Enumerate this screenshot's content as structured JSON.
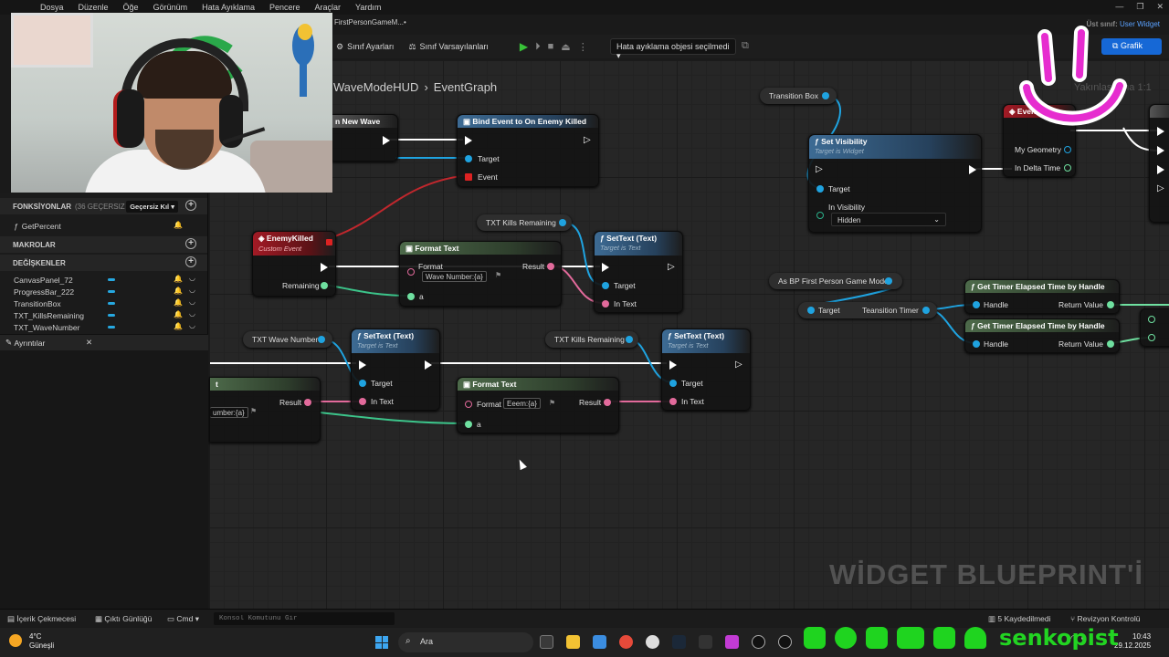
{
  "menu": [
    "Dosya",
    "Düzenle",
    "Öğe",
    "Görünüm",
    "Hata Ayıklama",
    "Pencere",
    "Araçlar",
    "Yardım"
  ],
  "tab_title": "FirstPersonGameM...•",
  "parent_class": {
    "label": "Üst sınıf:",
    "value": "User Widget"
  },
  "toolbar": {
    "class_settings": "Sınıf Ayarları",
    "class_defaults": "Sınıf Varsayılanları",
    "debug_select": "Hata ayıklama objesi seçilmedi",
    "graph_button": "Grafik"
  },
  "breadcrumb": {
    "widget": "WaveModeHUD",
    "sep": "›",
    "graph": "EventGraph"
  },
  "graph_faint_label": "Yakınlaştırma 1:1",
  "watermark": "WİDGET BLUEPRINT'İ",
  "left_panel": {
    "functions": {
      "title": "FONKSİYONLAR",
      "count": "(36 GEÇERSIZ KILIN",
      "override": "Geçersiz Kıl",
      "items": [
        "GetPercent"
      ]
    },
    "macros": {
      "title": "MAKROLAR"
    },
    "variables": {
      "title": "DEĞİŞKENLER",
      "items": [
        "CanvasPanel_72",
        "ProgressBar_222",
        "TransitionBox",
        "TXT_KillsRemaining",
        "TXT_WaveNumber"
      ]
    },
    "details_tab": "Ayrıntılar"
  },
  "nodes": {
    "on_new_wave": {
      "title": "n New Wave"
    },
    "bind_event": {
      "title": "Bind Event to On Enemy Killed",
      "pins": [
        "Target",
        "Event"
      ]
    },
    "enemy_killed": {
      "title": "EnemyKilled",
      "subtitle": "Custom Event",
      "pins": [
        "Remaining"
      ]
    },
    "format_text_1": {
      "title": "Format Text",
      "format_label": "Format",
      "format_value": "Wave Number:{a}",
      "result": "Result",
      "a": "a"
    },
    "settext_1": {
      "title": "SetText (Text)",
      "subtitle": "Target is Text",
      "pins": [
        "Target",
        "In Text"
      ]
    },
    "var_kills_1": "TXT Kills Remaining",
    "var_wave": "TXT Wave Number",
    "var_kills_2": "TXT Kills Remaining",
    "settext_2": {
      "title": "SetText (Text)",
      "subtitle": "Target is Text",
      "pins": [
        "Target",
        "In Text"
      ]
    },
    "settext_3": {
      "title": "SetText (Text)",
      "subtitle": "Target is Text",
      "pins": [
        "Target",
        "In Text"
      ]
    },
    "format_text_2": {
      "title": "Format Text",
      "format_label": "Format",
      "format_value": "Eeem:{a}",
      "result": "Result",
      "a": "a"
    },
    "left_partial": {
      "title": "t",
      "result": "Result",
      "format_value": "umber:{a}"
    },
    "transition_box": "Transition Box",
    "set_visibility": {
      "title": "Set Visibility",
      "subtitle": "Target is Widget",
      "pins": [
        "Target",
        "In Visibility"
      ],
      "visibility_value": "Hidden"
    },
    "event_tick": {
      "title": "Event Tick",
      "pins": [
        "My Geometry",
        "In Delta Time"
      ]
    },
    "cast_node": "As BP First Person Game Mode",
    "get_transition": {
      "target": "Target",
      "output": "Teansition Timer"
    },
    "timer_1": {
      "title": "Get Timer Elapsed Time by Handle",
      "handle": "Handle",
      "ret": "Return Value"
    },
    "timer_2": {
      "title": "Get Timer Elapsed Time by Handle",
      "handle": "Handle",
      "ret": "Return Value"
    }
  },
  "bottom_bar": {
    "content_drawer": "İçerik Çekmecesi",
    "output_log": "Çıktı Günlüğü",
    "cmd": "Cmd",
    "console_placeholder": "Konsol Komutunu Gir",
    "saved": "5 Kaydedilmedi",
    "revision": "Revizyon Kontrolü"
  },
  "taskbar": {
    "temperature": "4°C",
    "weather": "Güneşli",
    "search": "Ara",
    "time": "10:43",
    "date": "29.12.2025"
  },
  "social_brand": "senkopist",
  "colors": {
    "accent_blue": "#1668d6",
    "brand_green": "#22d422",
    "overlay_pink": "#e62ccf"
  }
}
